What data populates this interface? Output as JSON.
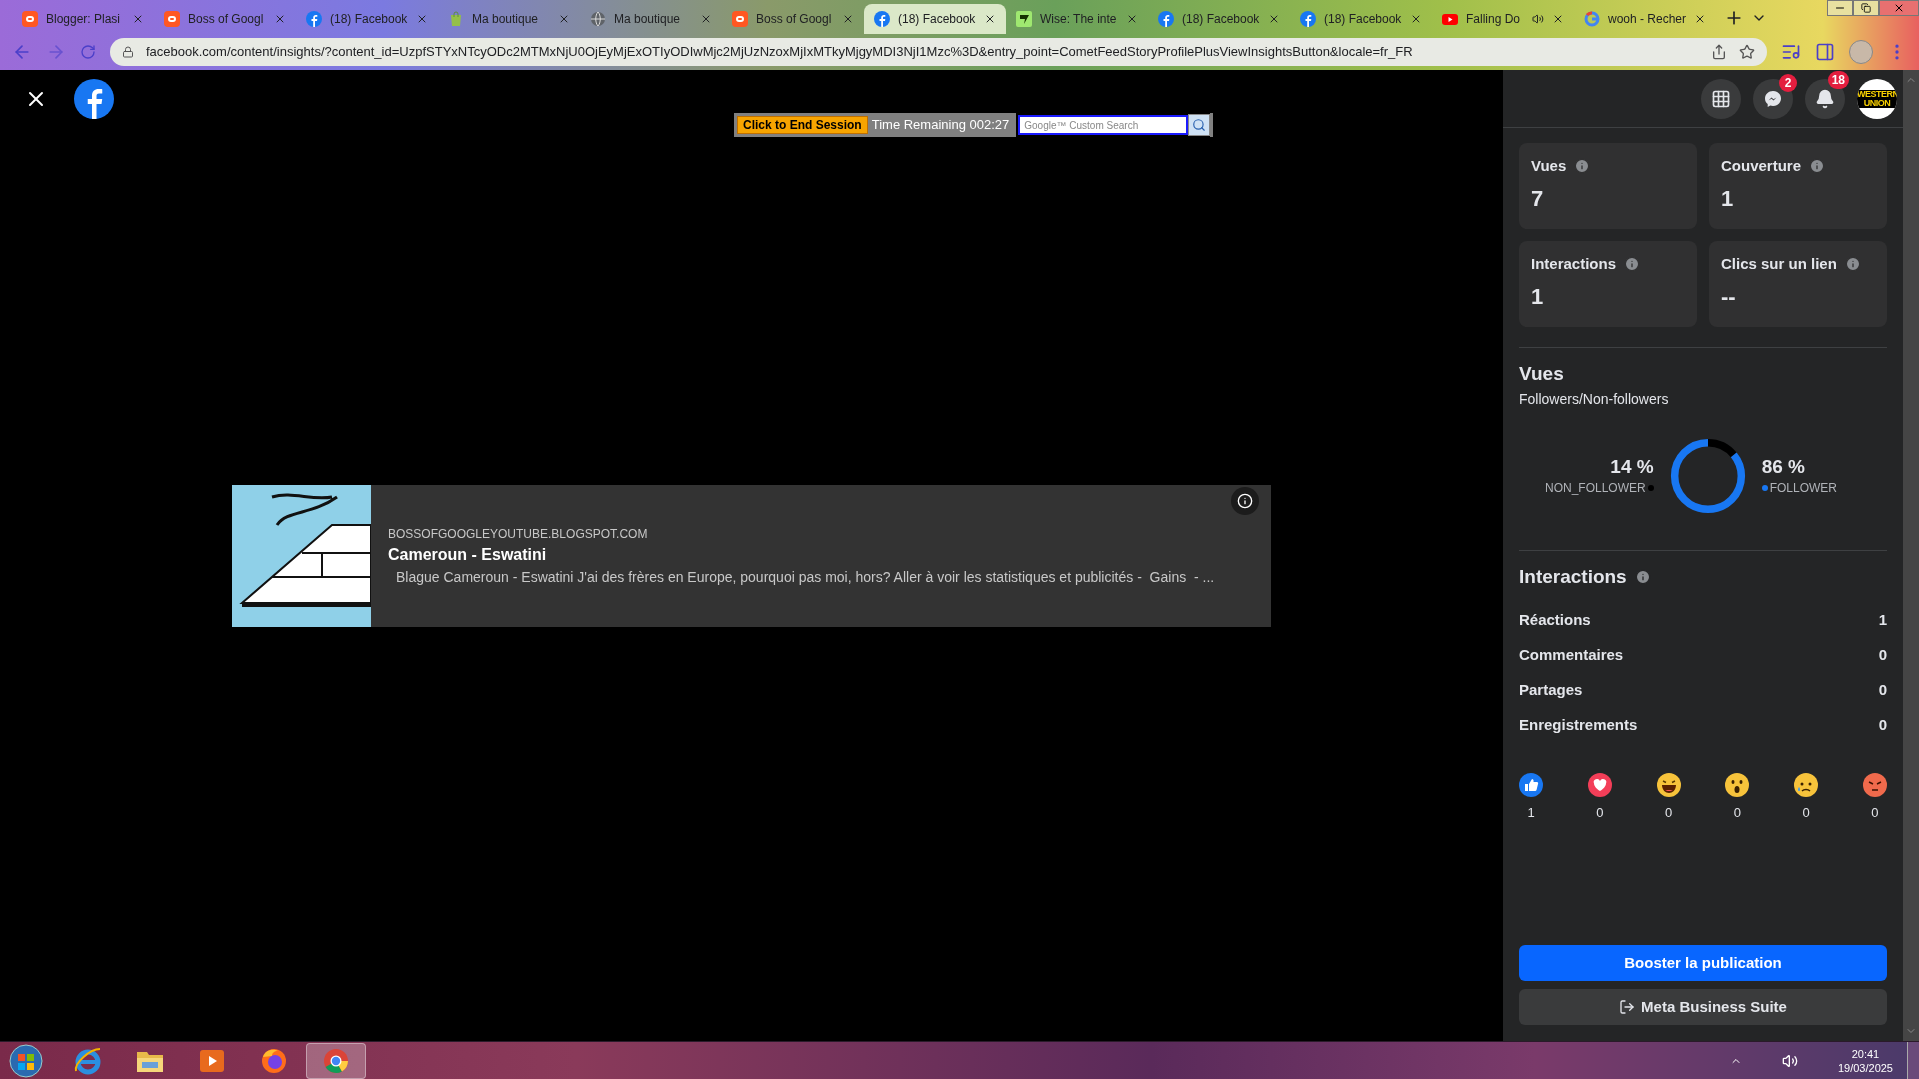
{
  "browser": {
    "tabs": [
      {
        "title": "Blogger: Plasi",
        "kind": "blogger",
        "selected": false,
        "audio": false
      },
      {
        "title": "Boss of Googl",
        "kind": "blogger",
        "selected": false,
        "audio": false
      },
      {
        "title": "(18) Facebook",
        "kind": "facebook",
        "selected": false,
        "audio": false
      },
      {
        "title": "Ma boutique",
        "kind": "shop",
        "selected": false,
        "audio": false
      },
      {
        "title": "Ma boutique",
        "kind": "globe",
        "selected": false,
        "audio": false
      },
      {
        "title": "Boss of Googl",
        "kind": "blogger",
        "selected": false,
        "audio": false
      },
      {
        "title": "(18) Facebook",
        "kind": "facebook",
        "selected": true,
        "audio": false
      },
      {
        "title": "Wise: The inte",
        "kind": "wise",
        "selected": false,
        "audio": false
      },
      {
        "title": "(18) Facebook",
        "kind": "facebook",
        "selected": false,
        "audio": false
      },
      {
        "title": "(18) Facebook",
        "kind": "facebook",
        "selected": false,
        "audio": false
      },
      {
        "title": "Falling Do",
        "kind": "youtube",
        "selected": false,
        "audio": true
      },
      {
        "title": "wooh - Recher",
        "kind": "google",
        "selected": false,
        "audio": false
      }
    ],
    "address": "facebook.com/content/insights/?content_id=UzpfSTYxNTcyODc2MTMxNjU0OjEyMjExOTIyODIwMjc2MjUzNzoxMjIxMTkyMjgyMDI3NjI1Mzc%3D&entry_point=CometFeedStoryProfilePlusViewInsightsButton&locale=fr_FR"
  },
  "session_bar": {
    "end_button": "Click to End Session",
    "time_remaining": "Time Remaining 002:27",
    "search_placeholder": "Google™ Custom Search"
  },
  "link_preview": {
    "domain": "BOSSOFGOOGLEYOUTUBE.BLOGSPOT.COM",
    "title": "Cameroun - Eswatini",
    "description": "Blague Cameroun - Eswatini J'ai des frères en Europe, pourquoi pas moi, hors? Aller à voir les statistiques et publicités -  Gains  - ..."
  },
  "header": {
    "messenger_badge": "2",
    "notifications_badge": "18",
    "avatar_text": "WESTERN UNION"
  },
  "metrics": [
    {
      "label": "Vues",
      "value": "7"
    },
    {
      "label": "Couverture",
      "value": "1"
    },
    {
      "label": "Interactions",
      "value": "1"
    },
    {
      "label": "Clics sur un lien",
      "value": "--"
    }
  ],
  "views": {
    "title": "Vues",
    "subtitle": "Followers/Non-followers",
    "chart_data": {
      "type": "donut",
      "categories": [
        "NON_FOLLOWER",
        "FOLLOWER"
      ],
      "series": [
        {
          "values": [
            14,
            86
          ]
        }
      ],
      "colors": [
        "#000000",
        "#1877f2"
      ],
      "value_labels": [
        "14 %",
        "86 %"
      ]
    }
  },
  "interactions": {
    "title": "Interactions",
    "rows": [
      {
        "label": "Réactions",
        "value": "1"
      },
      {
        "label": "Commentaires",
        "value": "0"
      },
      {
        "label": "Partages",
        "value": "0"
      },
      {
        "label": "Enregistrements",
        "value": "0"
      }
    ],
    "reactions": [
      {
        "kind": "like",
        "count": "1"
      },
      {
        "kind": "love",
        "count": "0"
      },
      {
        "kind": "haha",
        "count": "0"
      },
      {
        "kind": "wow",
        "count": "0"
      },
      {
        "kind": "sad",
        "count": "0"
      },
      {
        "kind": "angry",
        "count": "0"
      }
    ]
  },
  "buttons": {
    "boost": "Booster la publication",
    "business_suite": "Meta Business Suite"
  },
  "taskbar": {
    "apps": [
      {
        "kind": "ie",
        "selected": false
      },
      {
        "kind": "folder",
        "selected": false
      },
      {
        "kind": "media",
        "selected": false
      },
      {
        "kind": "firefox",
        "selected": false
      },
      {
        "kind": "chrome",
        "selected": true
      }
    ],
    "time": "20:41",
    "date": "19/03/2025"
  }
}
